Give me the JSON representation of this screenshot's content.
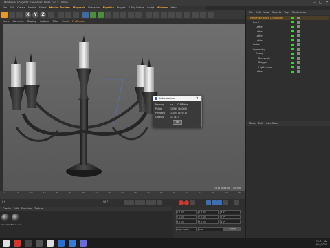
{
  "window": {
    "title": "Medieval Forged Chandelier Table.c4d * - Main",
    "min": "–",
    "max": "□",
    "close": "×"
  },
  "menubar": [
    "File",
    "Edit",
    "Create",
    "Modes",
    "Select",
    "Motion Tracker",
    "Mograph",
    "Character",
    "Pipeline",
    "Plugins",
    "V-Ray Bridge",
    "Script",
    "Window",
    "Help"
  ],
  "viewport_menu": [
    "View",
    "Cameras",
    "Display",
    "Options",
    "Filter",
    "Panel",
    "ProRender"
  ],
  "viewport": {
    "grid_spacing": "Grid Spacing : 10 cm"
  },
  "object_manager": {
    "menu": [
      "File",
      "Edit",
      "View",
      "Objects",
      "Tags",
      "Bookmarks"
    ],
    "items": [
      {
        "name": "Medieval Forged Chandelier",
        "selected": true,
        "indent": 0
      },
      {
        "name": "Box 1.1",
        "indent": 1
      },
      {
        "name": "Lathe",
        "indent": 2
      },
      {
        "name": "Lathe",
        "indent": 2
      },
      {
        "name": "Lathe",
        "indent": 2
      },
      {
        "name": "Lathe",
        "indent": 2
      },
      {
        "name": "Lathe",
        "indent": 1
      },
      {
        "name": "Symmetry",
        "indent": 1
      },
      {
        "name": "Sweep",
        "indent": 2
      },
      {
        "name": "Rectangle",
        "indent": 3
      },
      {
        "name": "Polygon",
        "indent": 3
      },
      {
        "name": "Light Lathe",
        "indent": 3
      },
      {
        "name": "Lathe",
        "indent": 2
      }
    ]
  },
  "attr_manager": {
    "menu": [
      "Mode",
      "Edit",
      "User Data"
    ]
  },
  "timeline": {
    "ticks": [
      "0",
      "5",
      "10",
      "15",
      "20",
      "25",
      "30",
      "35",
      "40",
      "45",
      "50",
      "55",
      "60",
      "65",
      "70",
      "75",
      "80",
      "85",
      "90"
    ],
    "frame_start": "0 F",
    "frame_end": "90 F",
    "current": "0 F"
  },
  "material_manager": {
    "menu": [
      "Create",
      "Edit",
      "Function",
      "Texture"
    ],
    "materials": [
      "Chandelier",
      "Metal chr"
    ]
  },
  "coordinates": {
    "rows": [
      {
        "a": "X 0 cm",
        "b": "X 0 cm",
        "c": "H 0°"
      },
      {
        "a": "Y 0 cm",
        "b": "Y 0 cm",
        "c": "P 0°"
      },
      {
        "a": "Z 0 cm",
        "b": "Z 0 cm",
        "c": "B 0°"
      }
    ],
    "mode": "Object (Rel)",
    "size_mode": "Size",
    "apply": "Apply"
  },
  "dialog": {
    "title": "Information",
    "rows": [
      {
        "k": "Memory",
        "v": "ca. 1.02 MBytes"
      },
      {
        "k": "Points",
        "v": "10945 (16085)"
      },
      {
        "k": "Polygons",
        "v": "11074 (15971)"
      },
      {
        "k": "Objects",
        "v": "13 (13)"
      }
    ],
    "ok": "OK"
  },
  "taskbar": {
    "time": "11:21 AM",
    "date": "6/14/2020"
  },
  "colors": {
    "accent": "#ffb14a",
    "selected_row": "#4b3e28"
  }
}
